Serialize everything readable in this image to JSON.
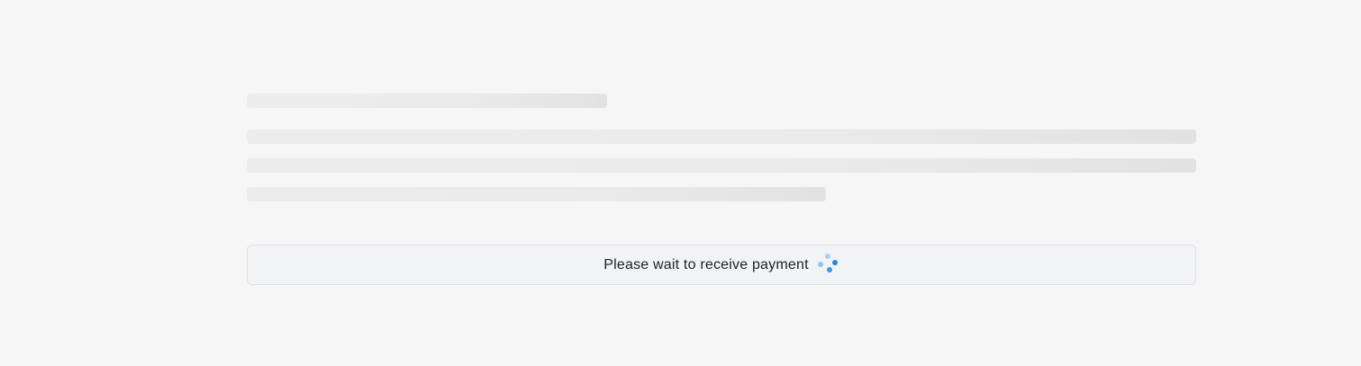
{
  "status": {
    "message": "Please wait to receive payment",
    "spinner_icon": "loading-spinner-icon",
    "spinner_color": "#1e88e5"
  },
  "skeleton": {
    "line_count": 4
  },
  "colors": {
    "background": "#f6f6f6",
    "skeleton": "#ebebeb",
    "status_box_bg": "#f2f3f5",
    "status_box_border": "#dcdfe4"
  }
}
